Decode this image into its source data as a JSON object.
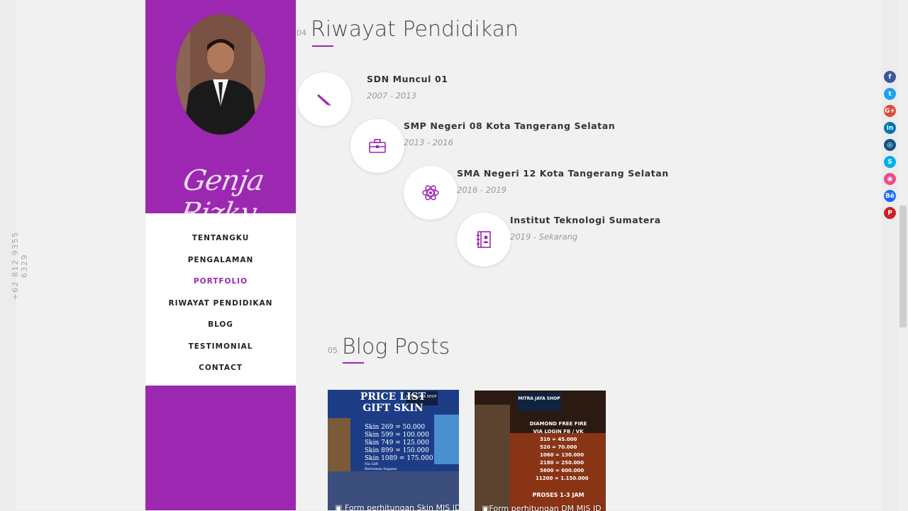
{
  "phone": "+62 812 9355 6329",
  "profile": {
    "signature": "Genja Rizky",
    "accent": "#9c27b0"
  },
  "nav": [
    {
      "label": "TENTANGKU",
      "active": false
    },
    {
      "label": "PENGALAMAN",
      "active": false
    },
    {
      "label": "PORTFOLIO",
      "active": true
    },
    {
      "label": "RIWAYAT PENDIDIKAN",
      "active": false
    },
    {
      "label": "BLOG",
      "active": false
    },
    {
      "label": "TESTIMONIAL",
      "active": false
    },
    {
      "label": "CONTACT",
      "active": false
    }
  ],
  "education": {
    "number": "04",
    "title": "Riwayat Pendidikan",
    "items": [
      {
        "name": "SDN Muncul 01",
        "years": "2007 - 2013",
        "icon": "pencil-icon"
      },
      {
        "name": "SMP Negeri 08 Kota Tangerang Selatan",
        "years": "2013 - 2016",
        "icon": "briefcase-icon"
      },
      {
        "name": "SMA Negeri 12 Kota Tangerang Selatan",
        "years": "2016 - 2019",
        "icon": "atom-icon"
      },
      {
        "name": "Institut Teknologi Sumatera",
        "years": "2019 - Sekarang",
        "icon": "contact-book-icon"
      }
    ]
  },
  "blog": {
    "number": "05",
    "title": "Blog Posts",
    "posts": [
      {
        "caption": "Form perhitungan Skin MIS ID",
        "image_title_1": "PRICE LIST",
        "image_title_2": "GIFT SKIN",
        "image_badge": "MITRA JAYA SHOP",
        "image_lines": [
          "Skin 269 = 50.000",
          "Skin 599 = 100.000",
          "Skin 749 = 125.000",
          "Skin 899 = 150.000",
          "Skin 1089 = 175.000"
        ],
        "image_footer_1": "Via Gift",
        "image_footer_2": "Berteman Ingame"
      },
      {
        "caption": "Form perhitungan DM MIS ID",
        "image_badge": "MITRA JAYA SHOP",
        "image_title_1": "DIAMOND FREE FIRE",
        "image_title_2": "VIA LOGIN FB / VK",
        "image_lines": [
          "310 = 45.000",
          "520 = 70.000",
          "1060 = 130.000",
          "2180 = 250.000",
          "5600 = 600.000",
          "11200 = 1.150.000"
        ],
        "image_footer_1": "PROSES 1-3 JAM"
      }
    ]
  },
  "social": [
    {
      "name": "facebook-icon",
      "glyph": "f",
      "color": "#3b5998"
    },
    {
      "name": "twitter-icon",
      "glyph": "t",
      "color": "#1da1f2"
    },
    {
      "name": "google-plus-icon",
      "glyph": "G+",
      "color": "#dd4b39"
    },
    {
      "name": "linkedin-icon",
      "glyph": "in",
      "color": "#0077b5"
    },
    {
      "name": "instagram-icon",
      "glyph": "◎",
      "color": "#125688"
    },
    {
      "name": "skype-icon",
      "glyph": "S",
      "color": "#00aff0"
    },
    {
      "name": "dribbble-icon",
      "glyph": "◉",
      "color": "#ea4c89"
    },
    {
      "name": "behance-icon",
      "glyph": "Bē",
      "color": "#1769ff"
    },
    {
      "name": "pinterest-icon",
      "glyph": "P",
      "color": "#cb2027"
    }
  ]
}
